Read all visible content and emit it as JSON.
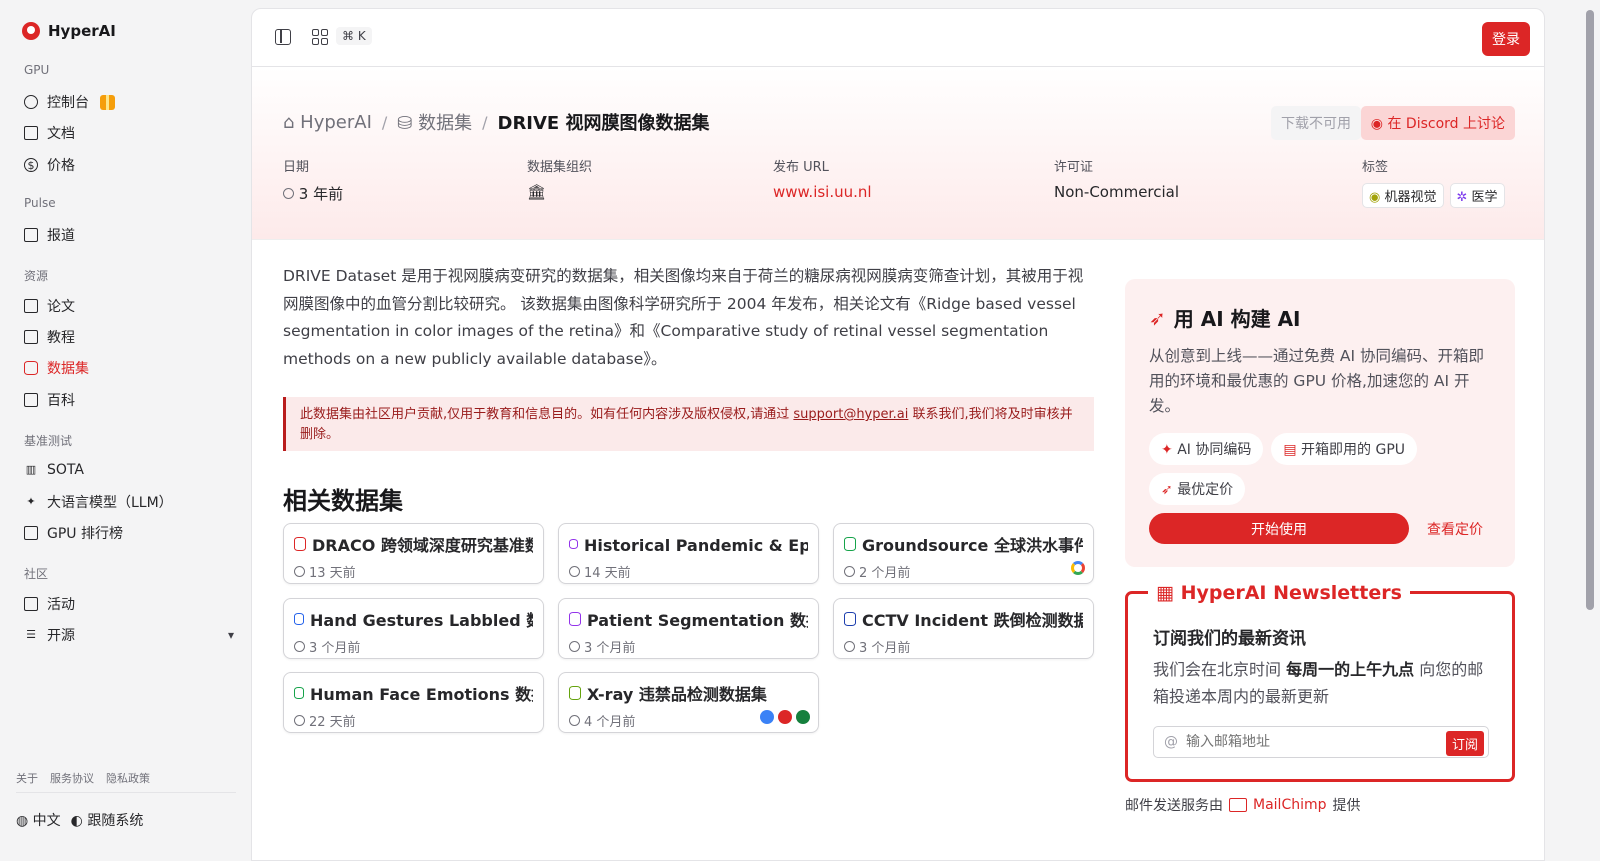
{
  "sidebar": {
    "brand": "HyperAI",
    "sections": {
      "gpu": "GPU",
      "pulse": "Pulse",
      "resources": "资源",
      "benchmark": "基准测试",
      "community": "社区"
    },
    "items": {
      "console": "控制台",
      "docs": "文档",
      "pricing": "价格",
      "reports": "报道",
      "papers": "论文",
      "tutorials": "教程",
      "datasets": "数据集",
      "wiki": "百科",
      "sota": "SOTA",
      "llm": "大语言模型（LLM）",
      "gpu_rank": "GPU 排行榜",
      "events": "活动",
      "open_source": "开源"
    },
    "footer": {
      "about": "关于",
      "terms": "服务协议",
      "privacy": "隐私政策",
      "language": "中文",
      "theme": "跟随系统"
    }
  },
  "topbar": {
    "shortcut": "⌘ K",
    "login": "登录"
  },
  "breadcrumb": {
    "home": "HyperAI",
    "datasets": "数据集",
    "current": "DRIVE 视网膜图像数据集"
  },
  "actions": {
    "download": "下载不可用",
    "discord": "在 Discord 上讨论"
  },
  "meta": {
    "date_label": "日期",
    "date_value": "3 年前",
    "org_label": "数据集组织",
    "url_label": "发布 URL",
    "url_value": "www.isi.uu.nl",
    "license_label": "许可证",
    "license_value": "Non-Commercial",
    "tags_label": "标签",
    "tags": [
      "机器视觉",
      "医学"
    ]
  },
  "description": "DRIVE Dataset 是用于视网膜病变研究的数据集，相关图像均来自于荷兰的糖尿病视网膜病变筛查计划，其被用于视网膜图像中的血管分割比较研究。 该数据集由图像科学研究所于 2004 年发布，相关论文有《Ridge based vessel segmentation in color images of the retina》和《Comparative study of retinal vessel segmentation methods on a new publicly available database》。",
  "notice": {
    "before": "此数据集由社区用户贡献,仅用于教育和信息目的。如有任何内容涉及版权侵权,请通过 ",
    "email": "support@hyper.ai",
    "after": " 联系我们,我们将及时审核并删除。"
  },
  "related": {
    "title": "相关数据集",
    "cards": [
      {
        "title": "DRACO 跨领域深度研究基准数据集",
        "time": "13 天前"
      },
      {
        "title": "Historical Pandemic & Epidemic 数据集",
        "time": "14 天前"
      },
      {
        "title": "Groundsource 全球洪水事件数据集",
        "time": "2 个月前"
      },
      {
        "title": "Hand Gestures Labbled 数据集",
        "time": "3 个月前"
      },
      {
        "title": "Patient Segmentation 数据集",
        "time": "3 个月前"
      },
      {
        "title": "CCTV Incident 跌倒检测数据集",
        "time": "3 个月前"
      },
      {
        "title": "Human Face Emotions 数据集",
        "time": "22 天前"
      },
      {
        "title": "X-ray 违禁品检测数据集",
        "time": "4 个月前"
      }
    ]
  },
  "promo": {
    "title": "用 AI 构建 AI",
    "text": "从创意到上线——通过免费 AI 协同编码、开箱即用的环境和最优惠的 GPU 价格,加速您的 AI 开发。",
    "chips": [
      "AI 协同编码",
      "开箱即用的 GPU",
      "最优定价"
    ],
    "start": "开始使用",
    "pricing": "查看定价"
  },
  "newsletter": {
    "title": "HyperAI Newsletters",
    "heading": "订阅我们的最新资讯",
    "text_before": "我们会在北京时间 ",
    "text_bold": "每周一的上午九点",
    "text_after": " 向您的邮箱投递本周内的最新更新",
    "placeholder": "输入邮箱地址",
    "subscribe": "订阅",
    "footer_before": "邮件发送服务由",
    "footer_brand": "MailChimp",
    "footer_after": "提供"
  },
  "colors": {
    "accent": "#dc2626"
  }
}
